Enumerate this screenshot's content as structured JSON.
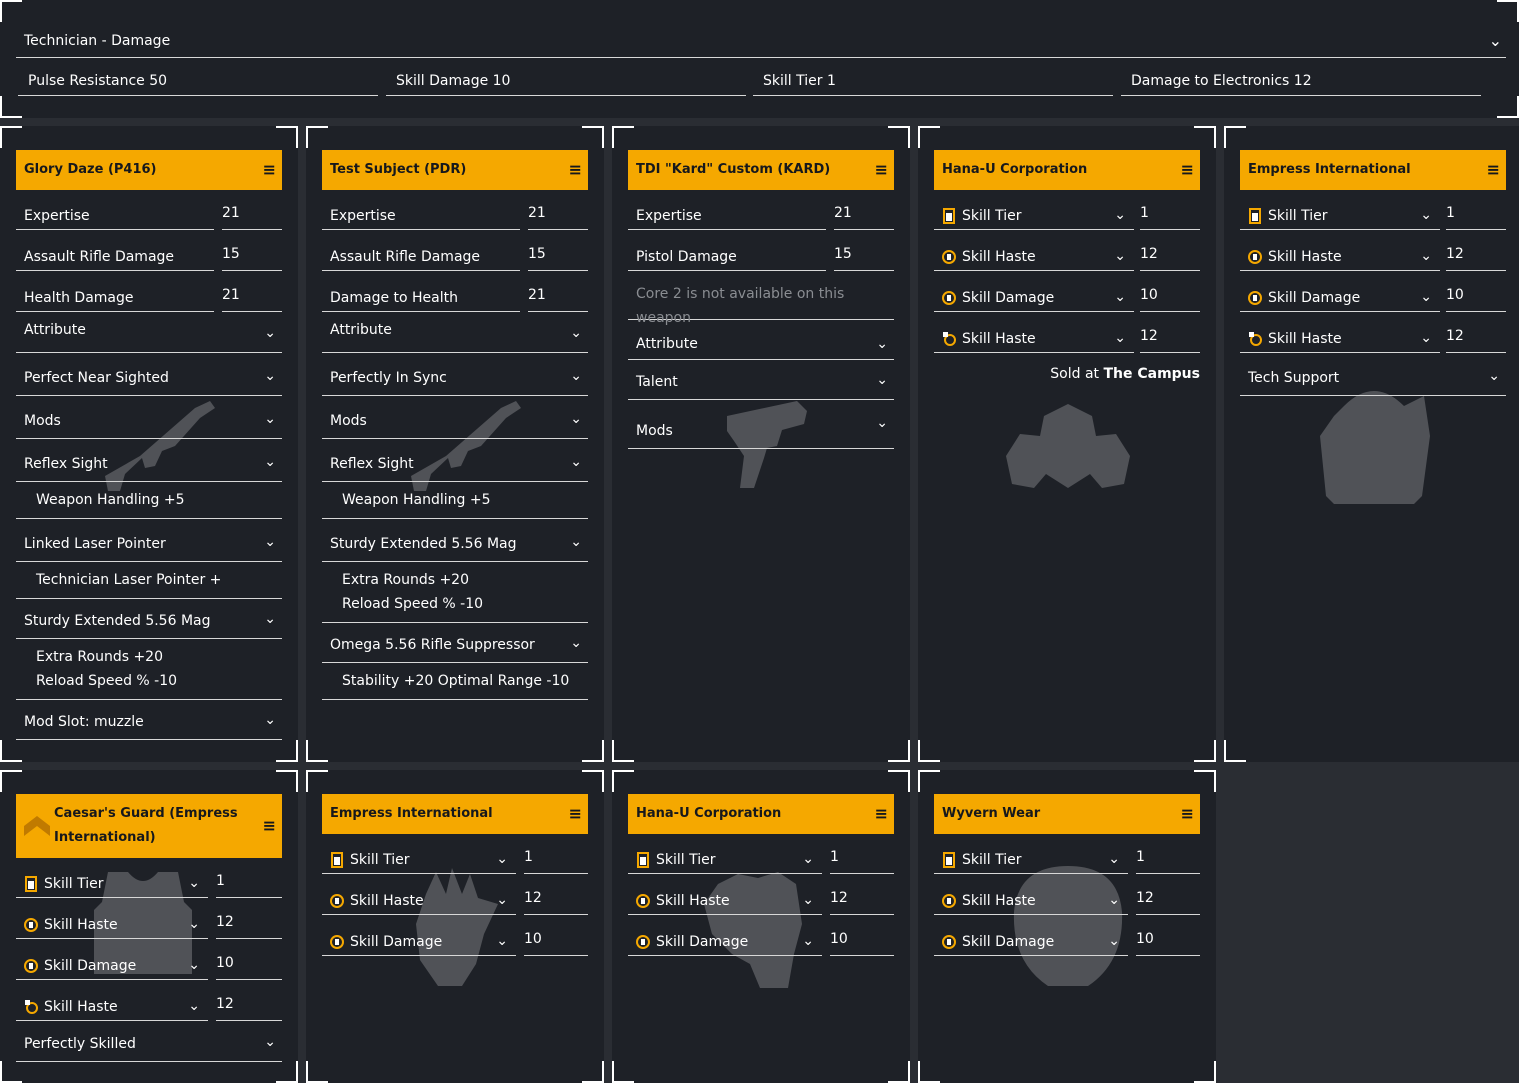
{
  "build": {
    "title": "Technician - Damage",
    "stats": [
      "Pulse Resistance 50",
      "Skill Damage 10",
      "Skill Tier 1",
      "Damage to Electronics 12"
    ]
  },
  "weapons": [
    {
      "header": "Glory Daze (P416)",
      "attrs": [
        {
          "name": "Expertise",
          "value": "21"
        },
        {
          "name": "Assault Rifle Damage",
          "value": "15"
        },
        {
          "name": "Health Damage",
          "value": "21"
        }
      ],
      "attribute_label": "Attribute",
      "talent": "Perfect Near Sighted",
      "mods_label": "Mods",
      "optic": "Reflex Sight",
      "optic_stats": "Weapon Handling +5",
      "underbarrel": "Linked Laser Pointer",
      "underbarrel_stats": "Technician Laser Pointer +",
      "magazine": "Sturdy Extended 5.56 Mag",
      "magazine_stats_1": "Extra Rounds +20",
      "magazine_stats_2": "Reload Speed % -10",
      "muzzle": "Mod Slot: muzzle"
    },
    {
      "header": "Test Subject (PDR)",
      "attrs": [
        {
          "name": "Expertise",
          "value": "21"
        },
        {
          "name": "Assault Rifle Damage",
          "value": "15"
        },
        {
          "name": "Damage to Health",
          "value": "21"
        }
      ],
      "attribute_label": "Attribute",
      "talent": "Perfectly In Sync",
      "mods_label": "Mods",
      "optic": "Reflex Sight",
      "optic_stats": "Weapon Handling +5",
      "magazine": "Sturdy Extended 5.56 Mag",
      "magazine_stats_1": "Extra Rounds +20",
      "magazine_stats_2": "Reload Speed % -10",
      "muzzle": "Omega 5.56 Rifle Suppressor",
      "muzzle_stats": "Stability +20  Optimal Range -10"
    },
    {
      "header": "TDI \"Kard\" Custom (KARD)",
      "attrs": [
        {
          "name": "Expertise",
          "value": "21"
        },
        {
          "name": "Pistol Damage",
          "value": "15"
        }
      ],
      "note": "Core 2 is not available on this weapon",
      "attribute_label": "Attribute",
      "talent_label": "Talent",
      "mods_label": "Mods"
    }
  ],
  "gear": [
    {
      "header": "Hana-U Corporation",
      "attrs": [
        {
          "icon": "skill-tier-icon",
          "name": "Skill Tier",
          "value": "1"
        },
        {
          "icon": "skill-haste-icon",
          "name": "Skill Haste",
          "value": "12"
        },
        {
          "icon": "skill-damage-icon",
          "name": "Skill Damage",
          "value": "10"
        },
        {
          "icon": "skill-haste-mod-icon",
          "name": "Skill Haste",
          "value": "12"
        }
      ],
      "sold_prefix": "Sold at ",
      "sold_place": "The Campus"
    },
    {
      "header": "Empress International",
      "attrs": [
        {
          "icon": "skill-tier-icon",
          "name": "Skill Tier",
          "value": "1"
        },
        {
          "icon": "skill-haste-icon",
          "name": "Skill Haste",
          "value": "12"
        },
        {
          "icon": "skill-damage-icon",
          "name": "Skill Damage",
          "value": "10"
        },
        {
          "icon": "skill-haste-mod-icon",
          "name": "Skill Haste",
          "value": "12"
        }
      ],
      "talent": "Tech Support"
    },
    {
      "header": "Caesar's Guard (Empress International)",
      "attrs": [
        {
          "icon": "skill-tier-icon",
          "name": "Skill Tier",
          "value": "1"
        },
        {
          "icon": "skill-haste-icon",
          "name": "Skill Haste",
          "value": "12"
        },
        {
          "icon": "skill-damage-icon",
          "name": "Skill Damage",
          "value": "10"
        },
        {
          "icon": "skill-haste-mod-icon",
          "name": "Skill Haste",
          "value": "12"
        }
      ],
      "talent": "Perfectly Skilled"
    },
    {
      "header": "Empress International",
      "attrs": [
        {
          "icon": "skill-tier-icon",
          "name": "Skill Tier",
          "value": "1"
        },
        {
          "icon": "skill-haste-icon",
          "name": "Skill Haste",
          "value": "12"
        },
        {
          "icon": "skill-damage-icon",
          "name": "Skill Damage",
          "value": "10"
        }
      ]
    },
    {
      "header": "Hana-U Corporation",
      "attrs": [
        {
          "icon": "skill-tier-icon",
          "name": "Skill Tier",
          "value": "1"
        },
        {
          "icon": "skill-haste-icon",
          "name": "Skill Haste",
          "value": "12"
        },
        {
          "icon": "skill-damage-icon",
          "name": "Skill Damage",
          "value": "10"
        }
      ]
    },
    {
      "header": "Wyvern Wear",
      "attrs": [
        {
          "icon": "skill-tier-icon",
          "name": "Skill Tier",
          "value": "1"
        },
        {
          "icon": "skill-haste-icon",
          "name": "Skill Haste",
          "value": "12"
        },
        {
          "icon": "skill-damage-icon",
          "name": "Skill Damage",
          "value": "10"
        }
      ]
    }
  ],
  "icons": {
    "menu": "≡",
    "chevron": "chevron-down-icon"
  },
  "colors": {
    "accent": "#f5a800",
    "panel": "#1e2127",
    "background": "#2a2d33",
    "line": "#d8d8d8",
    "muted": "#8a8d92"
  }
}
